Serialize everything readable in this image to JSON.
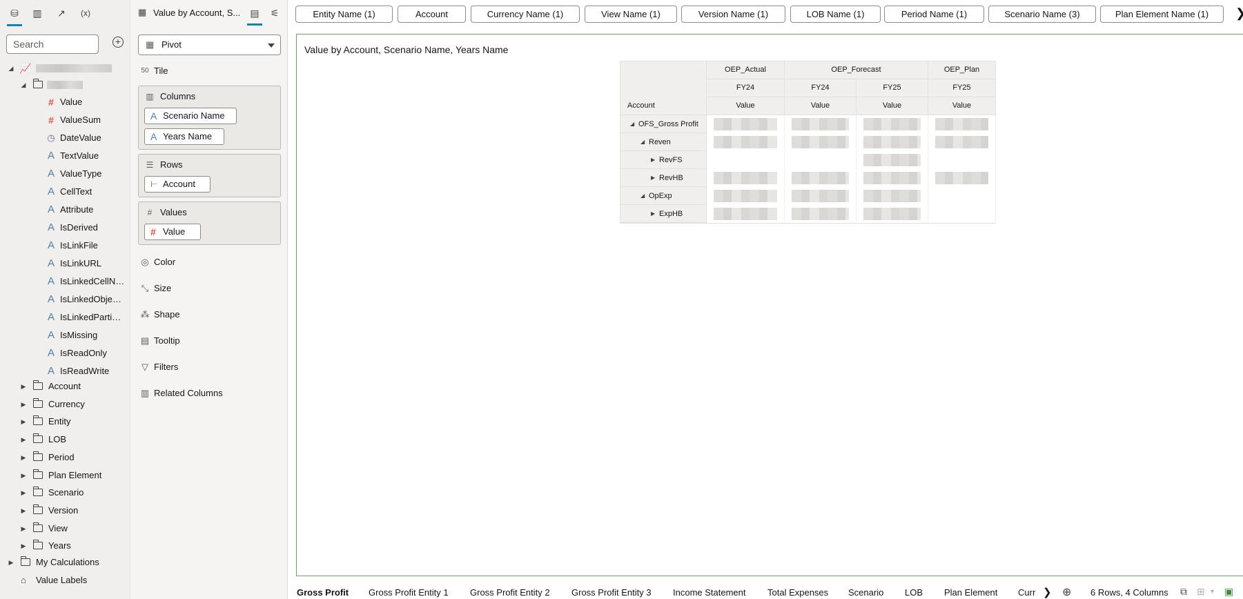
{
  "left_panel": {
    "tabs": [
      {
        "icon": "database-icon",
        "glyph": "⛁"
      },
      {
        "icon": "bar-chart-icon",
        "glyph": "▥"
      },
      {
        "icon": "trend-icon",
        "glyph": "↗"
      },
      {
        "icon": "expression-icon",
        "glyph": "(x)"
      }
    ],
    "search_placeholder": "Search",
    "fields": [
      {
        "label": "Value",
        "icon": "hash"
      },
      {
        "label": "ValueSum",
        "icon": "hash"
      },
      {
        "label": "DateValue",
        "icon": "clock"
      },
      {
        "label": "TextValue",
        "icon": "attribute"
      },
      {
        "label": "ValueType",
        "icon": "attribute"
      },
      {
        "label": "CellText",
        "icon": "attribute"
      },
      {
        "label": "Attribute",
        "icon": "attribute"
      },
      {
        "label": "IsDerived",
        "icon": "attribute"
      },
      {
        "label": "IsLinkFile",
        "icon": "attribute"
      },
      {
        "label": "IsLinkURL",
        "icon": "attribute"
      },
      {
        "label": "IsLinkedCellN…",
        "icon": "attribute"
      },
      {
        "label": "IsLinkedObje…",
        "icon": "attribute"
      },
      {
        "label": "IsLinkedParti…",
        "icon": "attribute"
      },
      {
        "label": "IsMissing",
        "icon": "attribute"
      },
      {
        "label": "IsReadOnly",
        "icon": "attribute"
      },
      {
        "label": "IsReadWrite",
        "icon": "attribute"
      }
    ],
    "folders": [
      "Account",
      "Currency",
      "Entity",
      "LOB",
      "Period",
      "Plan Element",
      "Scenario",
      "Version",
      "View",
      "Years"
    ],
    "my_calculations": "My Calculations",
    "value_labels": "Value Labels"
  },
  "grammar": {
    "title": "Value by Account, S...",
    "vis_type": "Pivot",
    "tile": "Tile",
    "columns_label": "Columns",
    "columns": [
      "Scenario Name",
      "Years Name"
    ],
    "rows_label": "Rows",
    "rows": [
      "Account"
    ],
    "values_label": "Values",
    "values": [
      "Value"
    ],
    "extra": [
      "Color",
      "Size",
      "Shape",
      "Tooltip",
      "Filters",
      "Related Columns"
    ]
  },
  "filters": [
    "Entity Name (1)",
    "Account",
    "Currency Name (1)",
    "View Name (1)",
    "Version Name (1)",
    "LOB Name (1)",
    "Period Name (1)",
    "Scenario Name (3)",
    "Plan Element Name (1)"
  ],
  "canvas": {
    "viz_title": "Value by Account, Scenario Name, Years Name",
    "pivot": {
      "row_header": "Account",
      "scenarios": [
        "OEP_Actual",
        "OEP_Forecast",
        "OEP_Plan"
      ],
      "years": [
        "FY24",
        "FY24",
        "FY25",
        "FY25"
      ],
      "measure": [
        "Value",
        "Value",
        "Value",
        "Value"
      ],
      "rows": [
        "OFS_Gross Profit",
        "Reven",
        "RevFS",
        "RevHB",
        "OpExp",
        "ExpHB"
      ]
    }
  },
  "bottom": {
    "tabs": [
      "Gross Profit",
      "Gross Profit Entity 1",
      "Gross Profit Entity 2",
      "Gross Profit Entity 3",
      "Income Statement",
      "Total Expenses",
      "Scenario",
      "LOB",
      "Plan Element",
      "Curr"
    ],
    "status": "6 Rows, 4 Columns"
  }
}
